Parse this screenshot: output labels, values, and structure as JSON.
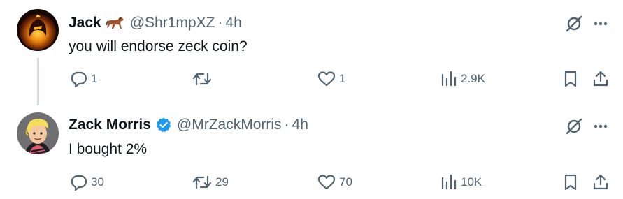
{
  "tweets": [
    {
      "name": "Jack",
      "name_emoji": "horse-emoji-icon",
      "handle": "@Shr1mpXZ",
      "separator": "·",
      "time": "4h",
      "text": "you will endorse zeck coin?",
      "counts": {
        "replies": "1",
        "reposts": "",
        "likes": "1",
        "views": "2.9K"
      }
    },
    {
      "name": "Zack Morris",
      "verified": true,
      "handle": "@MrZackMorris",
      "separator": "·",
      "time": "4h",
      "text": "I bought 2%",
      "counts": {
        "replies": "30",
        "reposts": "29",
        "likes": "70",
        "views": "10K"
      }
    }
  ],
  "colors": {
    "text_primary": "#0f1419",
    "text_secondary": "#536471",
    "verified_blue": "#1d9bf0",
    "thread_line": "#cfd9de"
  }
}
